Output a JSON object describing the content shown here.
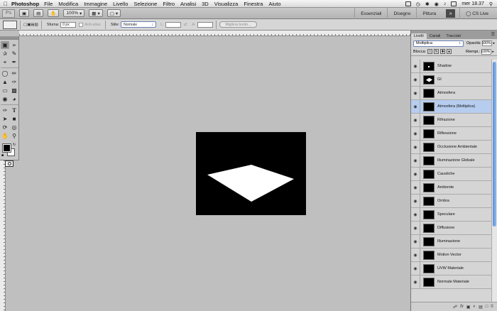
{
  "menubar": {
    "app_name": "Photoshop",
    "items": [
      "File",
      "Modifica",
      "Immagine",
      "Livello",
      "Selezione",
      "Filtro",
      "Analisi",
      "3D",
      "Visualizza",
      "Finestra",
      "Aiuto"
    ],
    "clock": "mer 18.37"
  },
  "appbar": {
    "logo": "Ps",
    "zoom": "100%",
    "workspaces": [
      "Essenziali",
      "Disegno",
      "Pittura"
    ],
    "cs_live": "CS Live"
  },
  "options": {
    "feather_label": "Sfuma:",
    "feather_value": "0 px",
    "antialias_label": "Anti-alias",
    "style_label": "Stile:",
    "style_value": "Normale",
    "width_label": "L:",
    "height_label": "A:",
    "refine_edge": "Migliora bordo..."
  },
  "layers_panel": {
    "tabs": [
      "Livelli",
      "Canali",
      "Tracciati"
    ],
    "blend_mode": "Moltiplica",
    "opacity_label": "Opacità:",
    "opacity_value": "100%",
    "lock_label": "Blocca:",
    "fill_label": "Riempi.:",
    "fill_value": "100%",
    "layers": [
      {
        "name": "Shadow",
        "thumb": "dot",
        "selected": false
      },
      {
        "name": "GI",
        "thumb": "diamond",
        "selected": false
      },
      {
        "name": "Atmosfera",
        "thumb": "black",
        "selected": false
      },
      {
        "name": "Atmosfera (Moltiplica)",
        "thumb": "black",
        "selected": true
      },
      {
        "name": "Rifrazione",
        "thumb": "black",
        "selected": false
      },
      {
        "name": "Riflessione",
        "thumb": "black",
        "selected": false
      },
      {
        "name": "Occlusione Ambientale",
        "thumb": "black",
        "selected": false
      },
      {
        "name": "Illuminazione Globale",
        "thumb": "black",
        "selected": false
      },
      {
        "name": "Caustiche",
        "thumb": "black",
        "selected": false
      },
      {
        "name": "Ambiente",
        "thumb": "black",
        "selected": false
      },
      {
        "name": "Ombra",
        "thumb": "black",
        "selected": false
      },
      {
        "name": "Speculare",
        "thumb": "black",
        "selected": false
      },
      {
        "name": "Diffusione",
        "thumb": "black",
        "selected": false
      },
      {
        "name": "Illuminazione",
        "thumb": "black",
        "selected": false
      },
      {
        "name": "Motion Vector",
        "thumb": "black",
        "selected": false
      },
      {
        "name": "UVW Materiale",
        "thumb": "black",
        "selected": false
      },
      {
        "name": "Normale Materiale",
        "thumb": "black",
        "selected": false
      }
    ],
    "footer_icons": [
      "link-icon",
      "fx-icon",
      "mask-icon",
      "adjustment-icon",
      "folder-icon",
      "new-layer-icon",
      "trash-icon"
    ]
  },
  "colors": {
    "canvas_bg": "#000000",
    "shape": "#ffffff",
    "selected_layer": "#b7cdef",
    "scroll_thumb": "#5a8fd8"
  }
}
